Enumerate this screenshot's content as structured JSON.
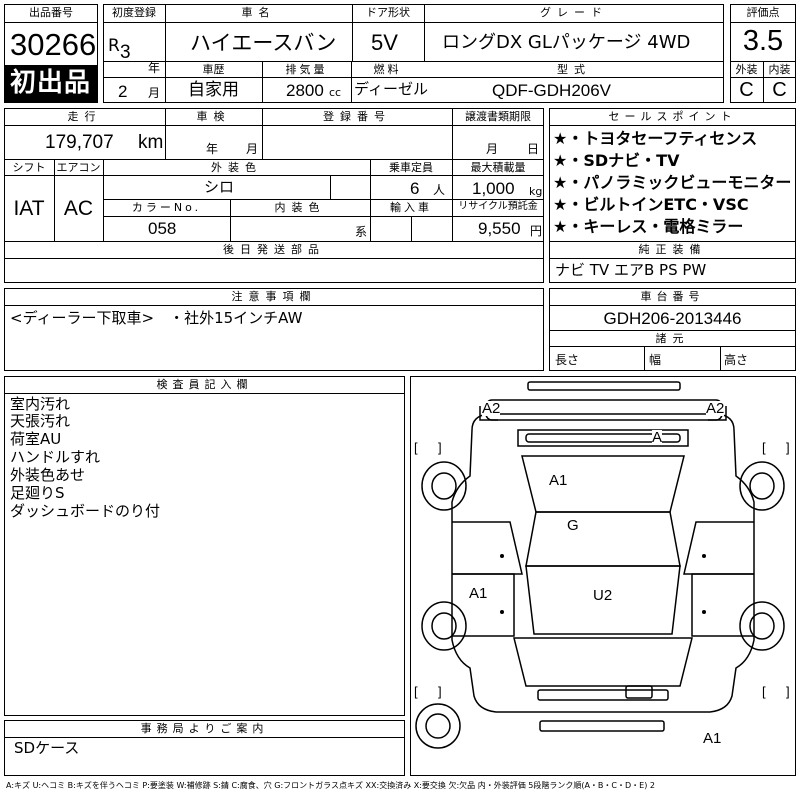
{
  "lot": {
    "label": "出品番号",
    "number": "30266",
    "first_listing": "初出品"
  },
  "first_registration": {
    "label": "初度登録",
    "era": "R",
    "year": "3",
    "year_unit": "年",
    "month": "2",
    "month_unit": "月"
  },
  "car_name": {
    "label": "車名",
    "value": "ハイエースバン"
  },
  "door": {
    "label": "ドア形状",
    "value": "5V"
  },
  "grade": {
    "label": "グレード",
    "value": "ロングDX GLパッケージ 4WD"
  },
  "score": {
    "label": "評価点",
    "value": "3.5"
  },
  "exterior_grade": {
    "label": "外装",
    "value": "C"
  },
  "interior_grade": {
    "label": "内装",
    "value": "C"
  },
  "history": {
    "label": "車歴",
    "value": "自家用"
  },
  "displacement": {
    "label": "排気量",
    "value": "2800",
    "unit": "cc"
  },
  "fuel": {
    "label": "燃料",
    "value": "ディーゼル"
  },
  "model_code": {
    "label": "型式",
    "value": "QDF-GDH206V"
  },
  "mileage": {
    "label": "走行",
    "value": "179,707",
    "unit": "km"
  },
  "inspection": {
    "label": "車検",
    "year_unit": "年",
    "month_unit": "月"
  },
  "registration_number": {
    "label": "登録番号",
    "value": ""
  },
  "transfer_deadline": {
    "label": "譲渡書類期限",
    "month_unit": "月",
    "day_unit": "日"
  },
  "sales_points": {
    "label": "セールスポイント",
    "items": [
      "★・トヨタセーフティセンス",
      "★・SDナビ・TV",
      "★・パノラミックビューモニター",
      "★・ビルトインETC・VSC",
      "★・キーレス・電格ミラー"
    ]
  },
  "shift": {
    "label": "シフト",
    "value": "IAT"
  },
  "aircon": {
    "label": "エアコン",
    "value": "AC"
  },
  "exterior_color": {
    "label": "外装色",
    "value": "シロ"
  },
  "capacity": {
    "label": "乗車定員",
    "value": "6",
    "unit": "人"
  },
  "max_load": {
    "label": "最大積載量",
    "value": "1,000",
    "unit": "kg"
  },
  "color_no": {
    "label": "カラーNo.",
    "value": "058"
  },
  "interior_color": {
    "label": "内装色",
    "unit": "系"
  },
  "import": {
    "label": "輸入車"
  },
  "recycle": {
    "label": "リサイクル預託金",
    "value": "9,550",
    "unit": "円"
  },
  "later_parts": {
    "label": "後日発送部品"
  },
  "genuine_equipment": {
    "label": "純正装備",
    "value": "ナビ TV エアB PS PW"
  },
  "notes": {
    "label": "注意事項欄",
    "value": "<ディーラー下取車>　・社外15インチAW"
  },
  "chassis": {
    "label": "車台番号",
    "value": "GDH206-2013446"
  },
  "dimensions": {
    "label": "諸元",
    "length": "長さ",
    "width": "幅",
    "height": "高さ"
  },
  "inspector": {
    "label": "検査員記入欄",
    "lines": [
      "室内汚れ",
      "天張汚れ",
      "荷室AU",
      "ハンドルすれ",
      "外装色あせ",
      "足廻りS",
      "ダッシュボードのり付"
    ]
  },
  "office": {
    "label": "事務局よりご案内",
    "value": "SDケース"
  },
  "diagram_marks": [
    "A2",
    "A2",
    "A",
    "A1",
    "G",
    "A1",
    "U2",
    "A1"
  ],
  "legend": "A:キズ U:ヘコミ B:キズを伴うヘコミ P:要塗装 W:補修跡 S:錆 C:腐食、穴 G:フロントガラス点キズ XX:交換済み X:要交換 欠:欠品 内・外装評価 5段階ランク順(A・B・C・D・E) 2"
}
